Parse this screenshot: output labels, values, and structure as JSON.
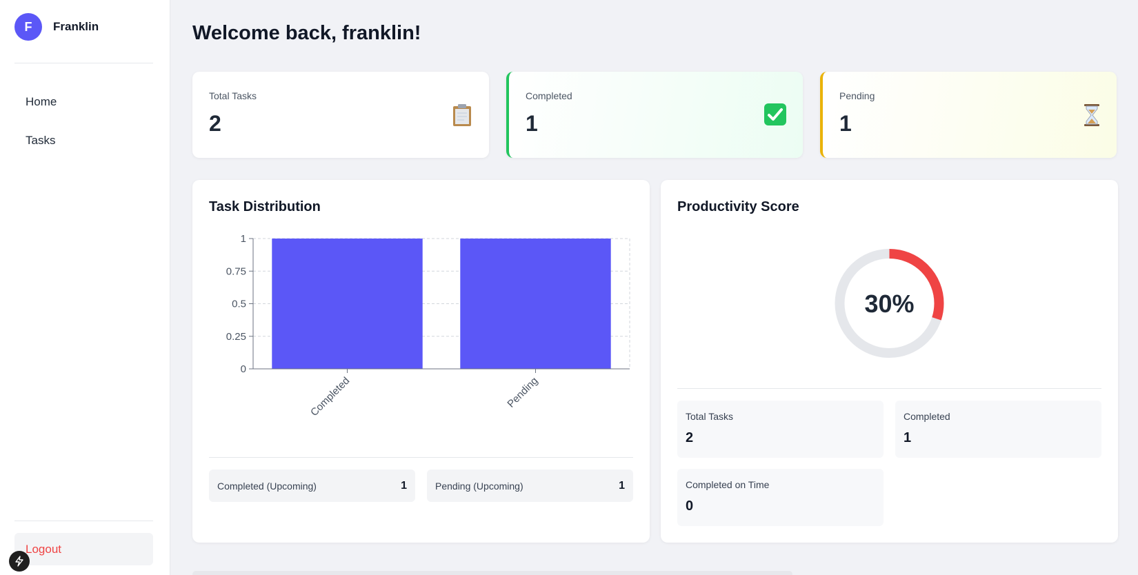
{
  "user": {
    "initial": "F",
    "name": "Franklin"
  },
  "nav": [
    {
      "label": "Home"
    },
    {
      "label": "Tasks"
    }
  ],
  "logout_label": "Logout",
  "page_title": "Welcome back, franklin!",
  "stats": [
    {
      "label": "Total Tasks",
      "value": "2",
      "icon": "clipboard-icon"
    },
    {
      "label": "Completed",
      "value": "1",
      "icon": "check-mark-icon",
      "accent": "#22c55e"
    },
    {
      "label": "Pending",
      "value": "1",
      "icon": "hourglass-icon",
      "accent": "#eab308"
    }
  ],
  "distribution": {
    "title": "Task Distribution",
    "legend": [
      {
        "label": "Completed (Upcoming)",
        "value": "1"
      },
      {
        "label": "Pending (Upcoming)",
        "value": "1"
      }
    ]
  },
  "chart_data": {
    "type": "bar",
    "categories": [
      "Completed",
      "Pending"
    ],
    "values": [
      1,
      1
    ],
    "yticks": [
      "0",
      "0.25",
      "0.5",
      "0.75",
      "1"
    ],
    "ylim": [
      0,
      1
    ],
    "grid": true,
    "bar_color": "#5b57f7"
  },
  "productivity": {
    "title": "Productivity Score",
    "score_text": "30%",
    "score": 0.3,
    "ring_color": "#ef4444",
    "track_color": "#e5e7eb",
    "stats": [
      {
        "label": "Total Tasks",
        "value": "2"
      },
      {
        "label": "Completed",
        "value": "1"
      },
      {
        "label": "Completed on Time",
        "value": "0"
      }
    ]
  }
}
